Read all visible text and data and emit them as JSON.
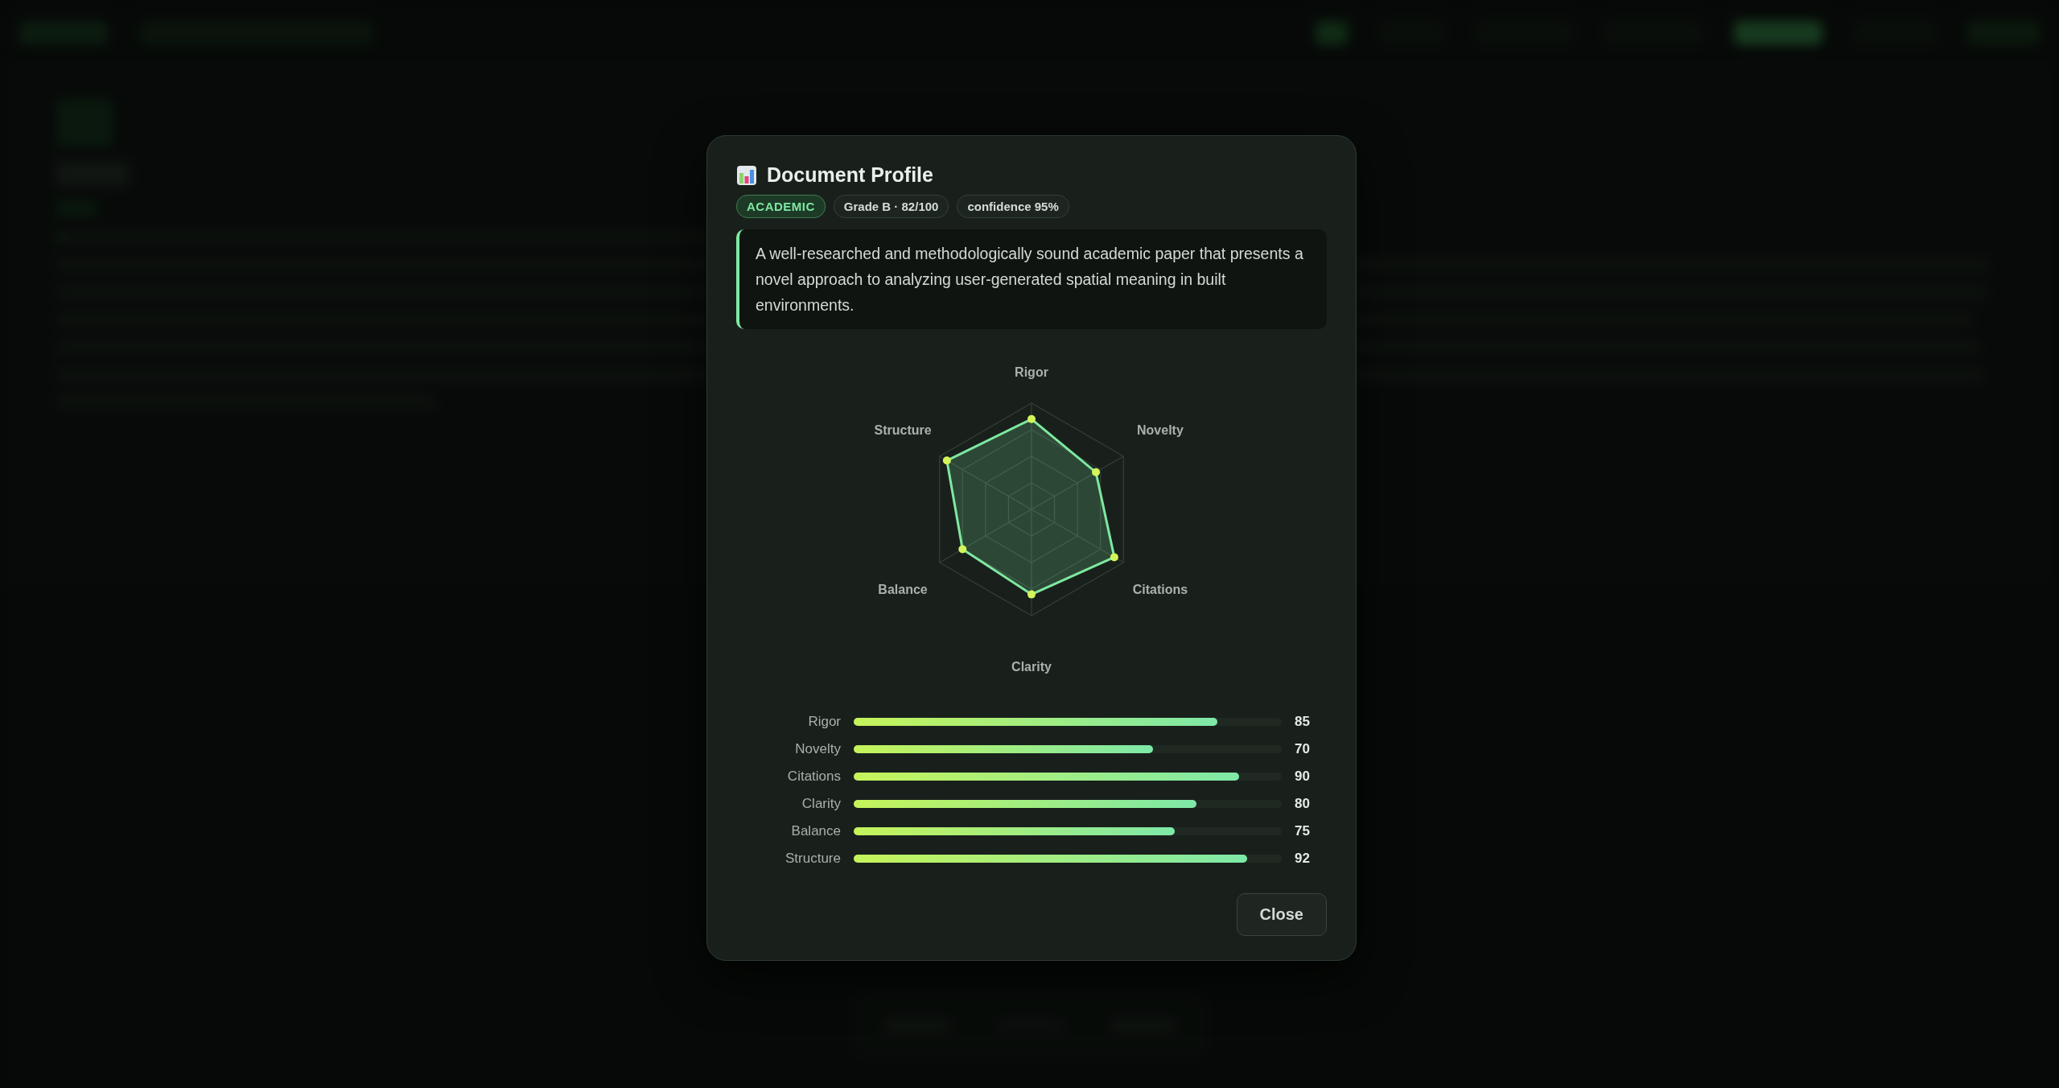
{
  "dialog": {
    "title": "Document Profile",
    "tags": [
      {
        "label": "ACADEMIC",
        "kind": "category"
      },
      {
        "label": "Grade B · 82/100",
        "kind": "info"
      },
      {
        "label": "confidence 95%",
        "kind": "info"
      }
    ],
    "summary": "A well-researched and methodologically sound academic paper that presents a novel approach to analyzing user-generated spatial meaning in built environments.",
    "radar_labels": [
      "Rigor",
      "Novelty",
      "Citations",
      "Clarity",
      "Balance",
      "Structure"
    ],
    "scores": [
      {
        "label": "Rigor",
        "level": 0.85,
        "value": "85"
      },
      {
        "label": "Novelty",
        "level": 0.7,
        "value": "70"
      },
      {
        "label": "Citations",
        "level": 0.9,
        "value": "90"
      },
      {
        "label": "Clarity",
        "level": 0.8,
        "value": "80"
      },
      {
        "label": "Balance",
        "level": 0.75,
        "value": "75"
      },
      {
        "label": "Structure",
        "level": 0.92,
        "value": "92"
      }
    ],
    "buttons": [
      "Close"
    ]
  }
}
